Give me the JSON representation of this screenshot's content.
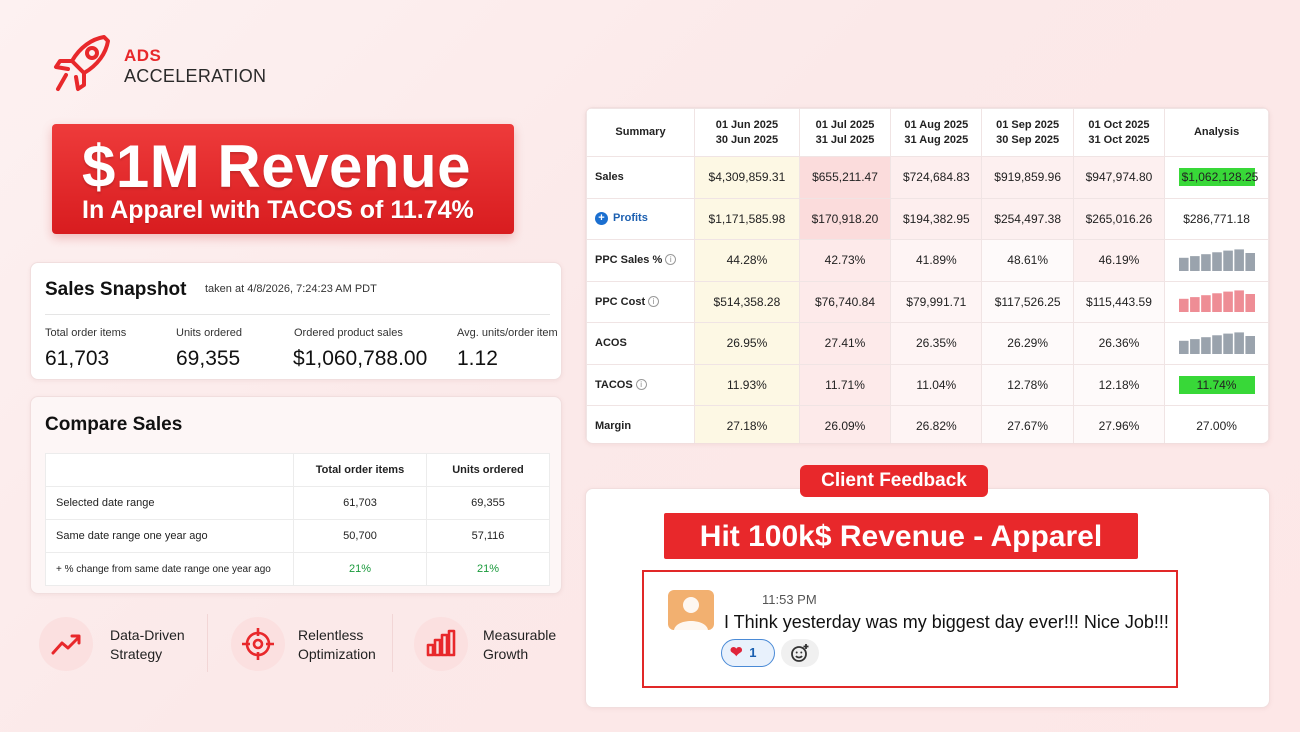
{
  "brand": {
    "line1": "ADS",
    "line2": "ACCELERATION",
    "accent": "#e8282b"
  },
  "banner": {
    "title": "$1M Revenue",
    "subtitle": "In Apparel with TACOS of 11.74%"
  },
  "snapshot": {
    "title": "Sales Snapshot",
    "taken": "taken at 4/8/2026, 7:24:23 AM PDT",
    "metrics": [
      {
        "label": "Total order items",
        "value": "61,703"
      },
      {
        "label": "Units ordered",
        "value": "69,355"
      },
      {
        "label": "Ordered product sales",
        "value": "$1,060,788.00"
      },
      {
        "label": "Avg. units/order item",
        "value": "1.12"
      }
    ]
  },
  "compare": {
    "title": "Compare Sales",
    "columns": [
      "",
      "Total order items",
      "Units ordered"
    ],
    "rows": [
      {
        "label": "Selected date range",
        "a": "61,703",
        "b": "69,355"
      },
      {
        "label": "Same date range one year ago",
        "a": "50,700",
        "b": "57,116"
      },
      {
        "label": "+ % change from same date range one year ago",
        "a": "21%",
        "b": "21%"
      }
    ]
  },
  "features": [
    {
      "icon": "trend-up-icon",
      "line1": "Data-Driven",
      "line2": "Strategy"
    },
    {
      "icon": "target-icon",
      "line1": "Relentless",
      "line2": "Optimization"
    },
    {
      "icon": "bar-chart-icon",
      "line1": "Measurable",
      "line2": "Growth"
    }
  ],
  "summary": {
    "headers": [
      {
        "l1": "Summary",
        "l2": ""
      },
      {
        "l1": "01 Jun 2025",
        "l2": "30 Jun 2025"
      },
      {
        "l1": "01 Jul 2025",
        "l2": "31 Jul 2025"
      },
      {
        "l1": "01 Aug 2025",
        "l2": "31 Aug 2025"
      },
      {
        "l1": "01 Sep 2025",
        "l2": "30 Sep 2025"
      },
      {
        "l1": "01 Oct 2025",
        "l2": "31 Oct 2025"
      },
      {
        "l1": "Analysis",
        "l2": ""
      }
    ],
    "rows": [
      {
        "label": "Sales",
        "vals": [
          "$4,309,859.31",
          "$655,211.47",
          "$724,684.83",
          "$919,859.96",
          "$947,974.80"
        ],
        "analysis": "$1,062,128.25"
      },
      {
        "label": "Profits",
        "vals": [
          "$1,171,585.98",
          "$170,918.20",
          "$194,382.95",
          "$254,497.38",
          "$265,016.26"
        ],
        "analysis": "$286,771.18"
      },
      {
        "label": "PPC Sales %",
        "vals": [
          "44.28%",
          "42.73%",
          "41.89%",
          "48.61%",
          "46.19%"
        ],
        "analysis": ""
      },
      {
        "label": "PPC Cost",
        "vals": [
          "$514,358.28",
          "$76,740.84",
          "$79,991.71",
          "$117,526.25",
          "$115,443.59"
        ],
        "analysis": ""
      },
      {
        "label": "ACOS",
        "vals": [
          "26.95%",
          "27.41%",
          "26.35%",
          "26.29%",
          "26.36%"
        ],
        "analysis": ""
      },
      {
        "label": "TACOS",
        "vals": [
          "11.93%",
          "11.71%",
          "11.04%",
          "12.78%",
          "12.18%"
        ],
        "analysis": "11.74%"
      },
      {
        "label": "Margin",
        "vals": [
          "27.18%",
          "26.09%",
          "26.82%",
          "27.67%",
          "27.96%"
        ],
        "analysis": "27.00%"
      }
    ],
    "sparklines": {
      "ppc_sales": [
        0.55,
        0.62,
        0.7,
        0.78,
        0.85,
        0.9,
        0.75
      ],
      "ppc_cost": [
        0.55,
        0.62,
        0.7,
        0.78,
        0.85,
        0.9,
        0.75
      ],
      "acos": [
        0.55,
        0.62,
        0.7,
        0.78,
        0.85,
        0.9,
        0.75
      ]
    },
    "highlight_color": "#38d838"
  },
  "feedback": {
    "badge": "Client Feedback",
    "title": "Hit 100k$ Revenue - Apparel",
    "time": "11:53 PM",
    "message": "I Think yesterday was my biggest day ever!!!  Nice Job!!!",
    "reaction_count": "1"
  }
}
